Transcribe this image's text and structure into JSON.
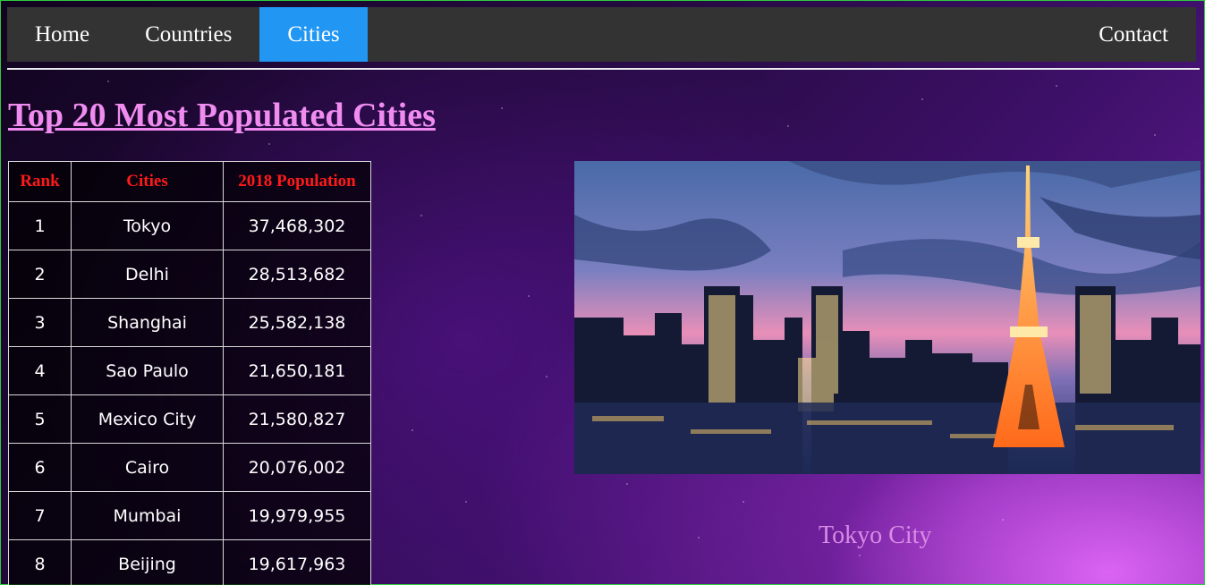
{
  "nav": {
    "items": [
      {
        "label": "Home",
        "active": false
      },
      {
        "label": "Countries",
        "active": false
      },
      {
        "label": "Cities",
        "active": true
      }
    ],
    "contact": "Contact",
    "active_color": "#2196f3"
  },
  "page": {
    "title": "Top 20 Most Populated Cities"
  },
  "table": {
    "headers": [
      "Rank",
      "Cities",
      "2018 Population"
    ],
    "rows": [
      {
        "rank": "1",
        "city": "Tokyo",
        "population": "37,468,302"
      },
      {
        "rank": "2",
        "city": "Delhi",
        "population": "28,513,682"
      },
      {
        "rank": "3",
        "city": "Shanghai",
        "population": "25,582,138"
      },
      {
        "rank": "4",
        "city": "Sao Paulo",
        "population": "21,650,181"
      },
      {
        "rank": "5",
        "city": "Mexico City",
        "population": "21,580,827"
      },
      {
        "rank": "6",
        "city": "Cairo",
        "population": "20,076,002"
      },
      {
        "rank": "7",
        "city": "Mumbai",
        "population": "19,979,955"
      },
      {
        "rank": "8",
        "city": "Beijing",
        "population": "19,617,963"
      }
    ]
  },
  "photo": {
    "caption": "Tokyo City",
    "icon": "tokyo-skyline-photo"
  }
}
